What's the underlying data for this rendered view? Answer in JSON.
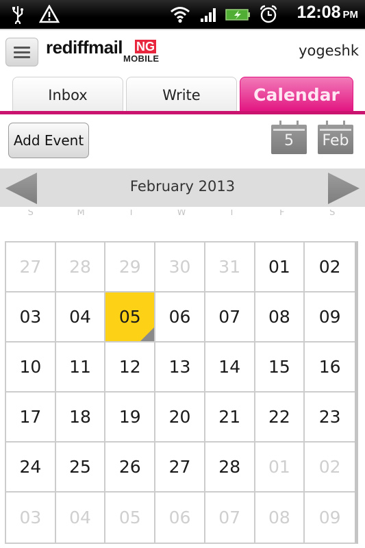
{
  "status_bar": {
    "time": "12:08",
    "ampm": "PM",
    "icons": [
      "usb-icon",
      "warning-icon",
      "wifi-icon",
      "signal-icon",
      "battery-charging-icon",
      "alarm-clock-icon"
    ]
  },
  "header": {
    "menu_icon": "hamburger-menu-icon",
    "logo_text": "rediffmail",
    "logo_badge": "NG",
    "logo_sub": "MOBILE",
    "username": "yogeshk"
  },
  "tabs": [
    {
      "label": "Inbox",
      "active": false
    },
    {
      "label": "Write",
      "active": false
    },
    {
      "label": "Calendar",
      "active": true
    }
  ],
  "toolbar": {
    "add_event_label": "Add Event",
    "day_view_label": "5",
    "month_view_label": "Feb"
  },
  "calendar": {
    "month_title": "February 2013",
    "prev_icon": "left-arrow-icon",
    "next_icon": "right-arrow-icon",
    "weekdays": [
      "S",
      "M",
      "T",
      "W",
      "T",
      "F",
      "S"
    ],
    "today": "05",
    "weeks": [
      [
        {
          "d": "27",
          "other": true
        },
        {
          "d": "28",
          "other": true
        },
        {
          "d": "29",
          "other": true
        },
        {
          "d": "30",
          "other": true
        },
        {
          "d": "31",
          "other": true
        },
        {
          "d": "01",
          "other": false
        },
        {
          "d": "02",
          "other": false
        }
      ],
      [
        {
          "d": "03",
          "other": false
        },
        {
          "d": "04",
          "other": false
        },
        {
          "d": "05",
          "other": false,
          "today": true
        },
        {
          "d": "06",
          "other": false
        },
        {
          "d": "07",
          "other": false
        },
        {
          "d": "08",
          "other": false
        },
        {
          "d": "09",
          "other": false
        }
      ],
      [
        {
          "d": "10",
          "other": false
        },
        {
          "d": "11",
          "other": false
        },
        {
          "d": "12",
          "other": false
        },
        {
          "d": "13",
          "other": false
        },
        {
          "d": "14",
          "other": false
        },
        {
          "d": "15",
          "other": false
        },
        {
          "d": "16",
          "other": false
        }
      ],
      [
        {
          "d": "17",
          "other": false
        },
        {
          "d": "18",
          "other": false
        },
        {
          "d": "19",
          "other": false
        },
        {
          "d": "20",
          "other": false
        },
        {
          "d": "21",
          "other": false
        },
        {
          "d": "22",
          "other": false
        },
        {
          "d": "23",
          "other": false
        }
      ],
      [
        {
          "d": "24",
          "other": false
        },
        {
          "d": "25",
          "other": false
        },
        {
          "d": "26",
          "other": false
        },
        {
          "d": "27",
          "other": false
        },
        {
          "d": "28",
          "other": false
        },
        {
          "d": "01",
          "other": true
        },
        {
          "d": "02",
          "other": true
        }
      ],
      [
        {
          "d": "03",
          "other": true
        },
        {
          "d": "04",
          "other": true
        },
        {
          "d": "05",
          "other": true
        },
        {
          "d": "06",
          "other": true
        },
        {
          "d": "07",
          "other": true
        },
        {
          "d": "08",
          "other": true
        },
        {
          "d": "09",
          "other": true
        }
      ]
    ]
  },
  "colors": {
    "accent": "#e1127f",
    "today_highlight": "#fcd116",
    "logo_badge": "#e8273f"
  }
}
